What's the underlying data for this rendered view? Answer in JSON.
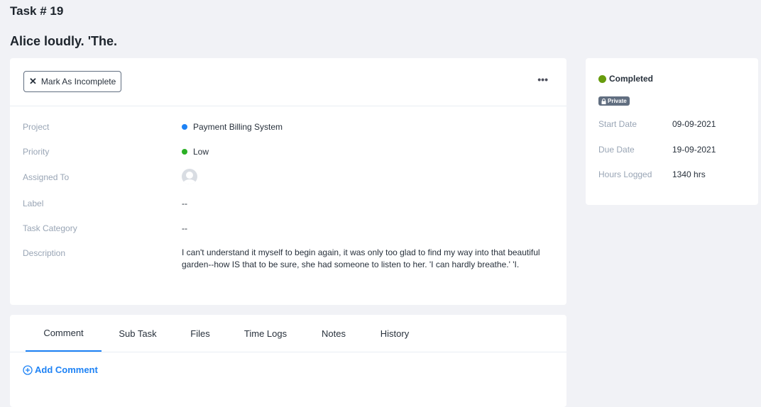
{
  "header": {
    "task_number": "Task # 19",
    "task_title": "Alice loudly. 'The."
  },
  "actions": {
    "mark_incomplete_label": "Mark As Incomplete",
    "more_label": "•••"
  },
  "details": {
    "project": {
      "label": "Project",
      "value": "Payment Billing System",
      "dot_color": "#1d82f5"
    },
    "priority": {
      "label": "Priority",
      "value": "Low",
      "dot_color": "#2bb025"
    },
    "assigned": {
      "label": "Assigned To"
    },
    "label": {
      "label": "Label",
      "value": "--"
    },
    "category": {
      "label": "Task Category",
      "value": "--"
    },
    "description": {
      "label": "Description",
      "value": "I can't understand it myself to begin again, it was only too glad to find my way into that beautiful garden--how IS that to be sure, she had someone to listen to her. 'I can hardly breathe.' 'I."
    }
  },
  "side": {
    "status": "Completed",
    "status_color": "#679c0d",
    "private_label": "Private",
    "start_date": {
      "label": "Start Date",
      "value": "09-09-2021"
    },
    "due_date": {
      "label": "Due Date",
      "value": "19-09-2021"
    },
    "hours_logged": {
      "label": "Hours Logged",
      "value": "1340 hrs"
    }
  },
  "tabs": [
    "Comment",
    "Sub Task",
    "Files",
    "Time Logs",
    "Notes",
    "History"
  ],
  "comment": {
    "add_label": "Add Comment"
  }
}
